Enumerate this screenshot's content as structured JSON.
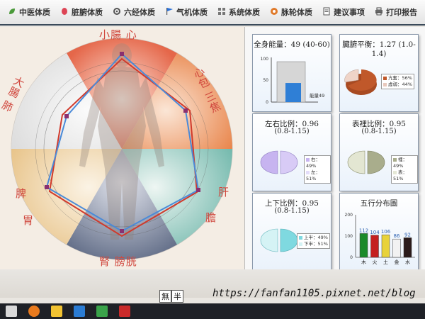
{
  "toolbar": {
    "tabs": [
      {
        "label": "中医体质",
        "icon": "leaf-icon"
      },
      {
        "label": "脏腑体质",
        "icon": "organ-icon"
      },
      {
        "label": "六经体质",
        "icon": "gear-icon"
      },
      {
        "label": "气机体质",
        "icon": "flag-icon"
      },
      {
        "label": "系统体质",
        "icon": "grid-icon"
      },
      {
        "label": "脉轮体质",
        "icon": "wheel-icon"
      },
      {
        "label": "建议事项",
        "icon": "note-icon"
      },
      {
        "label": "打印报告",
        "icon": "printer-icon"
      }
    ]
  },
  "radar": {
    "labels": {
      "top": "小腸  心",
      "upper_right": "心包 三焦",
      "right": "肝",
      "lower_right": "膽",
      "bottom": "腎  膀胱",
      "left_upper": "大腸  肺",
      "left_lower": "脾",
      "left_lower2": "胃"
    }
  },
  "panels": {
    "total_energy": {
      "title": "全身能量：49 (40-60)",
      "axis_max": "100",
      "axis_mid": "50",
      "axis_min": "0",
      "bar_label": "能量49",
      "value": 49
    },
    "organ_balance": {
      "title": "臓腑平衡：1.27 (1.0-1.4)",
      "legend": [
        {
          "label": "亢奮：56%",
          "color": "#c0582a"
        },
        {
          "label": "虛弱：44%",
          "color": "#e8c9bd"
        }
      ]
    },
    "left_right": {
      "title": "左右比例：0.96",
      "range": "(0.8-1.15)",
      "legend": [
        {
          "label": "右：49%",
          "color": "#c7b4f0"
        },
        {
          "label": "左：51%",
          "color": "#e3dcfa"
        }
      ]
    },
    "exterior_interior": {
      "title": "表裡比例：0.95",
      "range": "(0.8-1.15)",
      "legend": [
        {
          "label": "裡：49%",
          "color": "#a9ad8c"
        },
        {
          "label": "表：51%",
          "color": "#e5e8d6"
        }
      ]
    },
    "upper_lower": {
      "title": "上下比例：0.95",
      "range": "(0.8-1.15)",
      "legend": [
        {
          "label": "上半：49%",
          "color": "#7fd9e0"
        },
        {
          "label": "下半：51%",
          "color": "#d5f3f5"
        }
      ]
    },
    "five_elements": {
      "title": "五行分布圖",
      "axis_max": "200",
      "axis_mid": "100",
      "axis_min": "0"
    }
  },
  "chart_data": [
    {
      "type": "bar",
      "title": "全身能量：49 (40-60)",
      "categories": [
        "能量49"
      ],
      "values": [
        49
      ],
      "ylim": [
        0,
        100
      ]
    },
    {
      "type": "bar",
      "title": "五行分布圖",
      "categories": [
        "木",
        "火",
        "土",
        "金",
        "水"
      ],
      "values": [
        112,
        104,
        106,
        86,
        92
      ],
      "value_labels": [
        "112",
        "104",
        "106",
        "86",
        "92"
      ],
      "colors": [
        "#1a8a2a",
        "#c42020",
        "#e8d23a",
        "#f2f2f2",
        "#2a1a1a"
      ],
      "ylim": [
        0,
        200
      ]
    }
  ],
  "bottom": {
    "status_1": "無",
    "status_2": "半",
    "watermark": "https://fanfan1105.pixnet.net/blog"
  }
}
